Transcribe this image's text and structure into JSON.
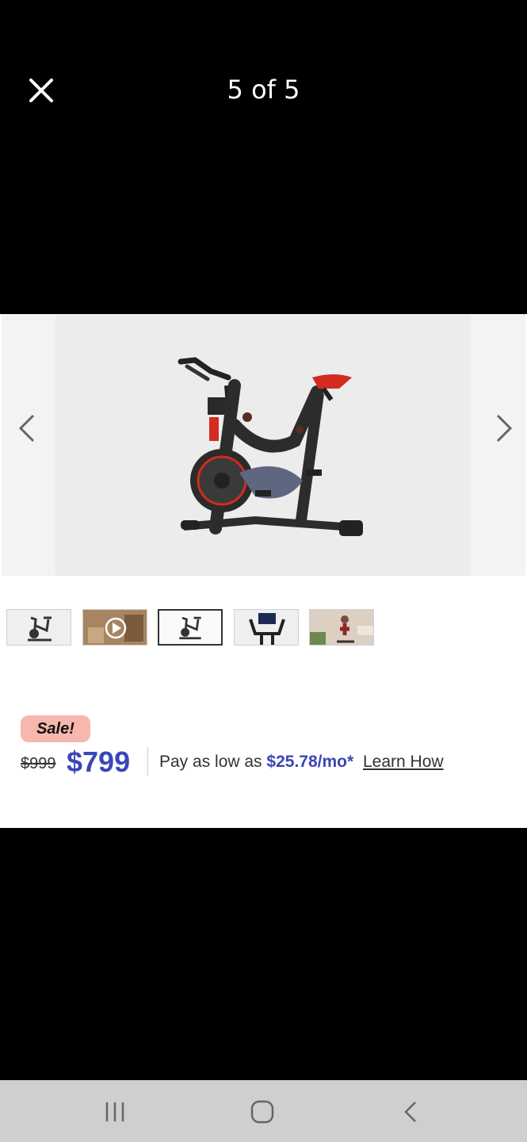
{
  "header": {
    "title": "5 of 5",
    "close_icon": "close-icon"
  },
  "gallery": {
    "prev_icon": "chevron-left-icon",
    "next_icon": "chevron-right-icon",
    "main_image": "exercise-bike-side-view",
    "thumbnails": [
      {
        "name": "bike-front-angle"
      },
      {
        "name": "bike-video-room",
        "icon": "play-icon"
      },
      {
        "name": "bike-side-view",
        "active": true
      },
      {
        "name": "bike-console-screen"
      },
      {
        "name": "bike-lifestyle-room"
      }
    ]
  },
  "pricing": {
    "badge": "Sale!",
    "old_price": "$999",
    "new_price": "$799",
    "finance_prefix": "Pay as low as",
    "finance_amount": "$25.78/mo*",
    "learn_label": "Learn How"
  },
  "colors": {
    "accent": "#3b46b7",
    "sale_badge": "#f8b7ae",
    "bike_red": "#d42a1f"
  },
  "system_nav": {
    "recents_icon": "recents-icon",
    "home_icon": "home-icon",
    "back_icon": "back-icon"
  }
}
